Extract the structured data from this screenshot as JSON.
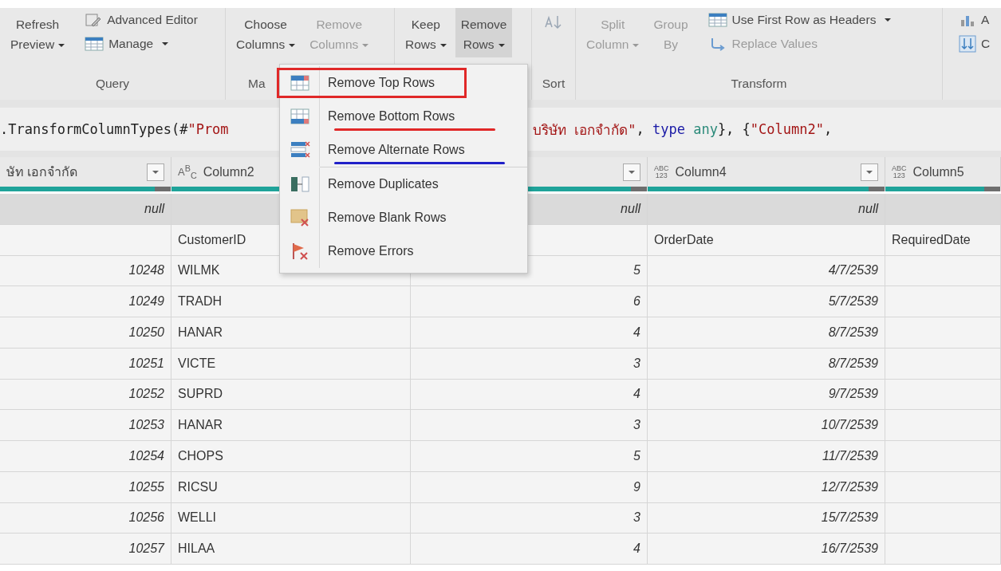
{
  "ribbon": {
    "groups": [
      {
        "label": "Query",
        "items": [
          {
            "kind": "large",
            "lines": [
              "Refresh",
              "Preview"
            ],
            "dropdown": true,
            "disabled": false,
            "pressed": false
          },
          {
            "kind": "stack",
            "entries": [
              {
                "kind": "editor",
                "label": "Advanced Editor",
                "dropdown": false,
                "disabled": false
              },
              {
                "kind": "table",
                "label": "Manage",
                "dropdown": true,
                "disabled": false
              }
            ]
          }
        ]
      },
      {
        "label": "Ma",
        "items": [
          {
            "kind": "large",
            "lines": [
              "Choose",
              "Columns"
            ],
            "dropdown": true,
            "disabled": false,
            "pressed": false
          },
          {
            "kind": "large",
            "lines": [
              "Remove",
              "Columns"
            ],
            "dropdown": true,
            "disabled": true,
            "pressed": false
          }
        ]
      },
      {
        "items": [
          {
            "kind": "large",
            "lines": [
              "Keep",
              "Rows"
            ],
            "dropdown": true,
            "disabled": false,
            "pressed": false
          },
          {
            "kind": "large",
            "lines": [
              "Remove",
              "Rows"
            ],
            "dropdown": true,
            "disabled": false,
            "pressed": true
          }
        ]
      },
      {
        "label": "Sort",
        "items": [
          {
            "kind": "sort"
          }
        ]
      },
      {
        "label": "Transform",
        "items": [
          {
            "kind": "large",
            "lines": [
              "Split",
              "Column"
            ],
            "dropdown": true,
            "disabled": true,
            "pressed": false
          },
          {
            "kind": "large",
            "lines": [
              "Group",
              "By"
            ],
            "dropdown": false,
            "disabled": true,
            "pressed": false
          },
          {
            "kind": "stack",
            "entries": [
              {
                "kind": "table",
                "label": "Use First Row as Headers",
                "dropdown": true,
                "disabled": false
              },
              {
                "kind": "replace",
                "label": "Replace Values",
                "dropdown": false,
                "disabled": true
              }
            ]
          }
        ]
      },
      {
        "items": [
          {
            "kind": "stack",
            "entries": [
              {
                "kind": "chart",
                "label": "A",
                "dropdown": false,
                "disabled": false
              },
              {
                "kind": "arrows",
                "label": "C",
                "dropdown": false,
                "disabled": false
              }
            ]
          }
        ]
      }
    ]
  },
  "formula": {
    "parts": [
      [
        {
          "text": ".TransformColumnTypes(#",
          "kind": "plain"
        },
        {
          "text": "\"Prom",
          "kind": "string"
        }
      ],
      [
        {
          "text": "บริษัท เอกจำกัด\"",
          "kind": "string"
        },
        {
          "text": ", ",
          "kind": "plain"
        },
        {
          "text": "type",
          "kind": "keyword"
        },
        {
          "text": " any",
          "kind": "type"
        },
        {
          "text": "}, {",
          "kind": "plain"
        },
        {
          "text": "\"Column2\"",
          "kind": "string"
        },
        {
          "text": ",",
          "kind": "plain"
        }
      ]
    ]
  },
  "grid": {
    "columns": [
      {
        "label": "ษัท เอกจำกัด",
        "filter": true
      },
      {
        "type_lines": [
          "A$^{B}$$_{C}$"
        ],
        "label": "Column2",
        "filter": false
      },
      {
        "filter": true
      },
      {
        "type_lines": [
          "ABC",
          "123"
        ],
        "label": "Column4",
        "filter": true
      },
      {
        "type_lines": [
          "ABC",
          "123"
        ],
        "label": "Column5",
        "filter": false
      }
    ],
    "rows": [
      {
        "selected": true,
        "cells": [
          {
            "text": "null",
            "kind": "value"
          },
          null,
          {
            "text": "null",
            "kind": "value"
          },
          {
            "text": "null",
            "kind": "value"
          },
          null
        ]
      },
      {
        "selected": false,
        "cells": [
          null,
          {
            "text": "CustomerID",
            "kind": "text"
          },
          null,
          {
            "text": "OrderDate",
            "kind": "text"
          },
          {
            "text": "RequiredDate",
            "kind": "text"
          }
        ]
      },
      {
        "selected": false,
        "cells": [
          {
            "text": "10248",
            "kind": "value"
          },
          {
            "text": "WILMK",
            "kind": "text"
          },
          {
            "text": "5",
            "kind": "value"
          },
          {
            "text": "4/7/2539",
            "kind": "value"
          },
          null
        ]
      },
      {
        "selected": false,
        "cells": [
          {
            "text": "10249",
            "kind": "value"
          },
          {
            "text": "TRADH",
            "kind": "text"
          },
          {
            "text": "6",
            "kind": "value"
          },
          {
            "text": "5/7/2539",
            "kind": "value"
          },
          null
        ]
      },
      {
        "selected": false,
        "cells": [
          {
            "text": "10250",
            "kind": "value"
          },
          {
            "text": "HANAR",
            "kind": "text"
          },
          {
            "text": "4",
            "kind": "value"
          },
          {
            "text": "8/7/2539",
            "kind": "value"
          },
          null
        ]
      },
      {
        "selected": false,
        "cells": [
          {
            "text": "10251",
            "kind": "value"
          },
          {
            "text": "VICTE",
            "kind": "text"
          },
          {
            "text": "3",
            "kind": "value"
          },
          {
            "text": "8/7/2539",
            "kind": "value"
          },
          null
        ]
      },
      {
        "selected": false,
        "cells": [
          {
            "text": "10252",
            "kind": "value"
          },
          {
            "text": "SUPRD",
            "kind": "text"
          },
          {
            "text": "4",
            "kind": "value"
          },
          {
            "text": "9/7/2539",
            "kind": "value"
          },
          null
        ]
      },
      {
        "selected": false,
        "cells": [
          {
            "text": "10253",
            "kind": "value"
          },
          {
            "text": "HANAR",
            "kind": "text"
          },
          {
            "text": "3",
            "kind": "value"
          },
          {
            "text": "10/7/2539",
            "kind": "value"
          },
          null
        ]
      },
      {
        "selected": false,
        "cells": [
          {
            "text": "10254",
            "kind": "value"
          },
          {
            "text": "CHOPS",
            "kind": "text"
          },
          {
            "text": "5",
            "kind": "value"
          },
          {
            "text": "11/7/2539",
            "kind": "value"
          },
          null
        ]
      },
      {
        "selected": false,
        "cells": [
          {
            "text": "10255",
            "kind": "value"
          },
          {
            "text": "RICSU",
            "kind": "text"
          },
          {
            "text": "9",
            "kind": "value"
          },
          {
            "text": "12/7/2539",
            "kind": "value"
          },
          null
        ]
      },
      {
        "selected": false,
        "cells": [
          {
            "text": "10256",
            "kind": "value"
          },
          {
            "text": "WELLI",
            "kind": "text"
          },
          {
            "text": "3",
            "kind": "value"
          },
          {
            "text": "15/7/2539",
            "kind": "value"
          },
          null
        ]
      },
      {
        "selected": false,
        "cells": [
          {
            "text": "10257",
            "kind": "value"
          },
          {
            "text": "HILAA",
            "kind": "text"
          },
          {
            "text": "4",
            "kind": "value"
          },
          {
            "text": "16/7/2539",
            "kind": "value"
          },
          null
        ]
      }
    ]
  },
  "menu": {
    "items": [
      {
        "kind": "top",
        "label": "Remove Top Rows",
        "separator_above": false,
        "highlighted": true
      },
      {
        "kind": "bottom",
        "label": "Remove Bottom Rows",
        "separator_above": false,
        "highlighted": false,
        "underline": {
          "color": "#e02828"
        }
      },
      {
        "kind": "alternate",
        "label": "Remove Alternate Rows",
        "separator_above": false,
        "highlighted": false,
        "underline": {
          "color": "#2020c8"
        }
      },
      {
        "kind": "duplicates",
        "label": "Remove Duplicates",
        "separator_above": true,
        "highlighted": false
      },
      {
        "kind": "blank",
        "label": "Remove Blank Rows",
        "separator_above": false,
        "highlighted": false
      },
      {
        "kind": "errors",
        "label": "Remove Errors",
        "separator_above": false,
        "highlighted": false
      }
    ]
  }
}
